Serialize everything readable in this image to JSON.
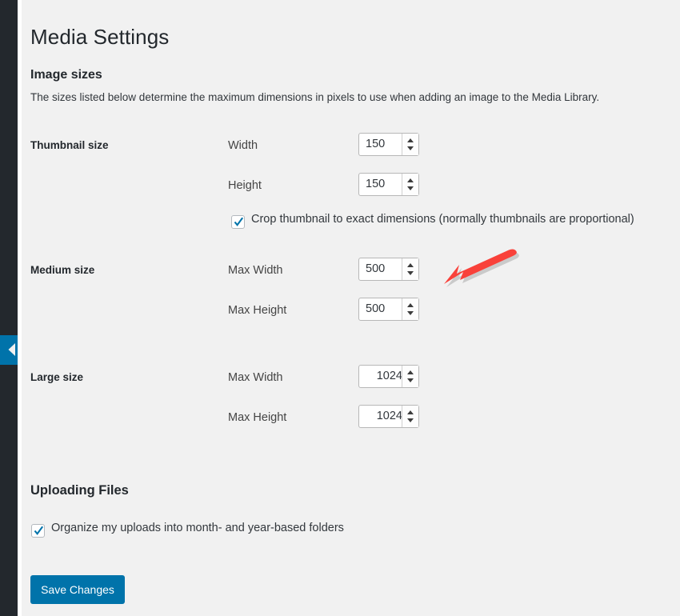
{
  "page": {
    "title": "Media Settings",
    "background_color": "#f1f1f1"
  },
  "admin_rail": {
    "background_color": "#23282d",
    "collapse_tab": {
      "color": "#0073aa",
      "icon": "chevron-left-icon"
    }
  },
  "sections": [
    {
      "id": "image-sizes",
      "heading": "Image sizes",
      "description": "The sizes listed below determine the maximum dimensions in pixels to use when adding an image to the Media Library."
    },
    {
      "id": "uploading-files",
      "heading": "Uploading Files"
    }
  ],
  "settings": {
    "thumbnail": {
      "label": "Thumbnail size",
      "width": {
        "label": "Width",
        "value": "150"
      },
      "height": {
        "label": "Height",
        "value": "150"
      },
      "crop": {
        "label": "Crop thumbnail to exact dimensions (normally thumbnails are proportional)",
        "checked": true
      }
    },
    "medium": {
      "label": "Medium size",
      "max_width": {
        "label": "Max Width",
        "value": "500"
      },
      "max_height": {
        "label": "Max Height",
        "value": "500"
      }
    },
    "large": {
      "label": "Large size",
      "max_width": {
        "label": "Max Width",
        "value": "1024"
      },
      "max_height": {
        "label": "Max Height",
        "value": "1024"
      }
    },
    "organize_uploads": {
      "label": "Organize my uploads into month- and year-based folders",
      "checked": true
    }
  },
  "actions": {
    "save_label": "Save Changes",
    "save_color": "#0073aa"
  },
  "annotation": {
    "type": "arrow",
    "color": "#f9413a",
    "points_to": "Medium size Max Width field",
    "direction": "left"
  }
}
